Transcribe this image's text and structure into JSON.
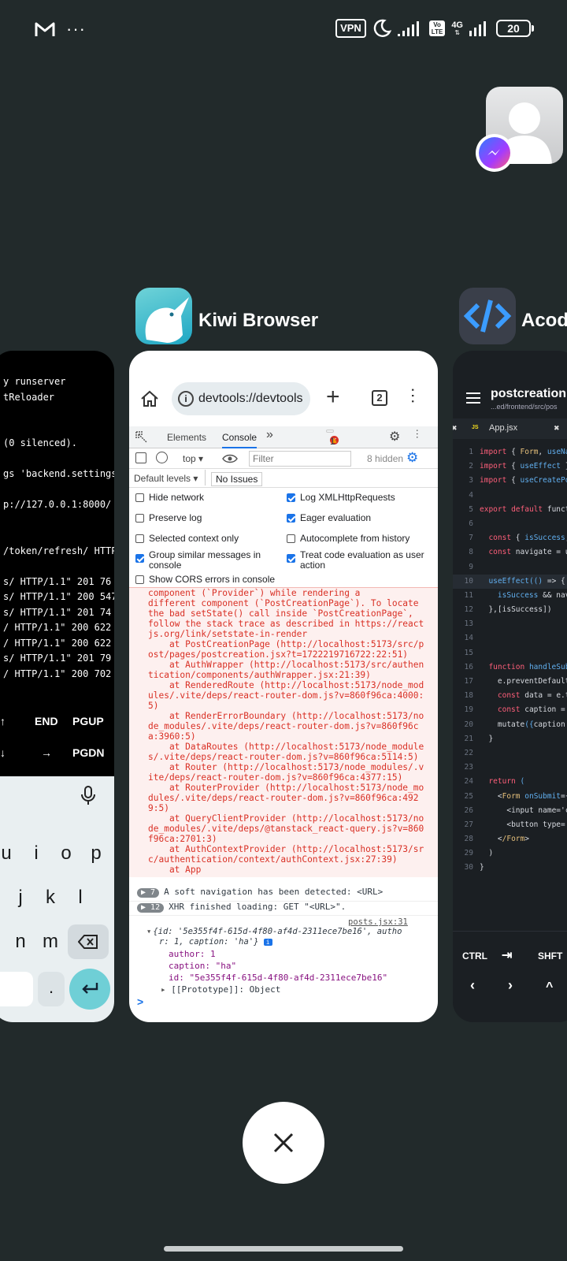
{
  "status_bar": {
    "vpn": "VPN",
    "volte": "Vo\nLTE",
    "network": "4G",
    "battery": "20"
  },
  "apps": {
    "termux": {
      "lines_top": [
        "y runserver",
        "tReloader",
        "",
        "",
        "(0 silenced).",
        "",
        "gs 'backend.settings",
        "",
        "p://127.0.0.1:8000/",
        "",
        "",
        "/token/refresh/ HTTP",
        "",
        "s/ HTTP/1.1\" 201 76",
        "s/ HTTP/1.1\" 200 547",
        "s/ HTTP/1.1\" 201 74",
        "/ HTTP/1.1\" 200 622",
        "/ HTTP/1.1\" 200 622",
        "s/ HTTP/1.1\" 201 79",
        "/ HTTP/1.1\" 200 702"
      ],
      "extra_keys_row1": [
        "↑",
        "END",
        "PGUP"
      ],
      "extra_keys_row2": [
        "↓",
        "→",
        "PGDN"
      ],
      "keyboard_row1": [
        "u",
        "i",
        "o",
        "p"
      ],
      "keyboard_row2": [
        "j",
        "k",
        "l"
      ],
      "keyboard_row3": [
        "n",
        "m"
      ],
      "keyboard_row4": [
        "."
      ]
    },
    "kiwi": {
      "title": "Kiwi Browser",
      "url": "devtools://devtools",
      "tab_count": "2",
      "devtools_tabs": [
        "Elements",
        "Console"
      ],
      "error_count": "1",
      "warn_count": "1",
      "context": "top",
      "filter_placeholder": "Filter",
      "hidden": "8 hidden",
      "default_levels": "Default levels ▾",
      "no_issues": "No Issues",
      "options": [
        {
          "label": "Hide network",
          "checked": false
        },
        {
          "label": "Log XMLHttpRequests",
          "checked": true
        },
        {
          "label": "Preserve log",
          "checked": false
        },
        {
          "label": "Eager evaluation",
          "checked": true
        },
        {
          "label": "Selected context only",
          "checked": false
        },
        {
          "label": "Autocomplete from history",
          "checked": false
        },
        {
          "label": "Group similar messages in console",
          "checked": true
        },
        {
          "label": "Treat code evaluation as user action",
          "checked": true
        },
        {
          "label": "Show CORS errors in console",
          "checked": false
        }
      ],
      "error_text": [
        "component (`Provider`) while rendering a",
        "different component (`PostCreationPage`). To locate",
        "the bad setState() call inside `PostCreationPage`,",
        "follow the stack trace as described in https://react",
        "js.org/link/setstate-in-render",
        "    at PostCreationPage (http://localhost:5173/src/p",
        "ost/pages/postcreation.jsx?t=1722219716722:22:51)",
        "    at AuthWrapper (http://localhost:5173/src/authen",
        "tication/components/authWrapper.jsx:21:39)",
        "    at RenderedRoute (http://localhost:5173/node_mod",
        "ules/.vite/deps/react-router-dom.js?v=860f96ca:4000:",
        "5)",
        "    at RenderErrorBoundary (http://localhost:5173/no",
        "de_modules/.vite/deps/react-router-dom.js?v=860f96c",
        "a:3960:5)",
        "    at DataRoutes (http://localhost:5173/node_module",
        "s/.vite/deps/react-router-dom.js?v=860f96ca:5114:5)",
        "    at Router (http://localhost:5173/node_modules/.v",
        "ite/deps/react-router-dom.js?v=860f96ca:4377:15)",
        "    at RouterProvider (http://localhost:5173/node_mo",
        "dules/.vite/deps/react-router-dom.js?v=860f96ca:492",
        "9:5)",
        "    at QueryClientProvider (http://localhost:5173/no",
        "de_modules/.vite/deps/@tanstack_react-query.js?v=860",
        "f96ca:2701:3)",
        "    at AuthContextProvider (http://localhost:5173/sr",
        "c/authentication/context/authContext.jsx:27:39)",
        "    at App"
      ],
      "log_soft_nav_count": "7",
      "log_soft_nav": "A soft navigation has been detected: <URL>",
      "log_xhr_count": "12",
      "log_xhr": "XHR finished loading: GET \"<URL>\".",
      "log_source": "posts.jsx:31",
      "obj_line1": "{id: '5e355f4f-615d-4f80-af4d-2311ece7be16', autho",
      "obj_line2": "r: 1, caption: 'ha'}",
      "obj_author": "author: 1",
      "obj_caption": "caption: \"ha\"",
      "obj_id": "id: \"5e355f4f-615d-4f80-af4d-2311ece7be16\"",
      "obj_proto": "[[Prototype]]: Object",
      "prompt": ">"
    },
    "acode": {
      "title": "Acode",
      "file_title": "postcreation.",
      "file_path": "...ed/frontend/src/pos",
      "tab": "App.jsx",
      "lines": [
        [
          "1",
          "import { Form, useNavi"
        ],
        [
          "2",
          "import { useEffect } f"
        ],
        [
          "3",
          "import { useCreatePost"
        ],
        [
          "4",
          ""
        ],
        [
          "5",
          "export default functio"
        ],
        [
          "6",
          ""
        ],
        [
          "7",
          "  const { isSuccess, e"
        ],
        [
          "8",
          "  const navigate = use"
        ],
        [
          "9",
          ""
        ],
        [
          "10",
          "  useEffect(() => {"
        ],
        [
          "11",
          "    isSuccess && navig"
        ],
        [
          "12",
          "  },[isSuccess])"
        ],
        [
          "13",
          ""
        ],
        [
          "14",
          ""
        ],
        [
          "15",
          ""
        ],
        [
          "16",
          "  function handleSubmi"
        ],
        [
          "17",
          "    e.preventDefault()"
        ],
        [
          "18",
          "    const data = e.tar"
        ],
        [
          "19",
          "    const caption = da"
        ],
        [
          "20",
          "    mutate({caption:ca"
        ],
        [
          "21",
          "  }"
        ],
        [
          "22",
          ""
        ],
        [
          "23",
          ""
        ],
        [
          "24",
          "  return ("
        ],
        [
          "25",
          "    <Form onSubmit={"
        ],
        [
          "26",
          "      <input name='c"
        ],
        [
          "27",
          "      <button type='"
        ],
        [
          "28",
          "    </Form>"
        ],
        [
          "29",
          "  )"
        ],
        [
          "30",
          "}"
        ]
      ],
      "keys_row1": [
        "CTRL",
        "⇥",
        "SHFT"
      ],
      "keys_row2": [
        "‹",
        "›",
        "^"
      ]
    }
  },
  "colors": {
    "background": "#222a2b",
    "error_bg": "#fdf0ef",
    "error_text": "#d93025",
    "kiwi_accent": "#1a73e8",
    "acode_icon": "#3a3f4a"
  }
}
